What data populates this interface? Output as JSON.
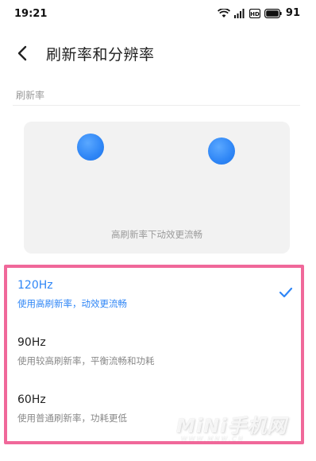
{
  "status_bar": {
    "time": "19:21",
    "battery": "91",
    "icons": [
      "wifi-icon",
      "signal-icon",
      "hd-icon",
      "battery-icon"
    ]
  },
  "header": {
    "title": "刷新率和分辨率",
    "back_icon": "chevron-left-icon"
  },
  "section": {
    "label": "刷新率"
  },
  "preview": {
    "caption": "高刷新率下动效更流畅",
    "dot_color": "#2f86f6"
  },
  "options": [
    {
      "title": "120Hz",
      "desc": "使用高刷新率，动效更流畅",
      "selected": true
    },
    {
      "title": "90Hz",
      "desc": "使用较高刷新率，平衡流畅和功耗",
      "selected": false
    },
    {
      "title": "60Hz",
      "desc": "使用普通刷新率，功耗更低",
      "selected": false
    }
  ],
  "watermark": {
    "main": "MiNi手机网",
    "sub": "WWW.MNW.CN"
  },
  "colors": {
    "accent": "#2f86f6",
    "highlight_border": "#f0689a"
  }
}
